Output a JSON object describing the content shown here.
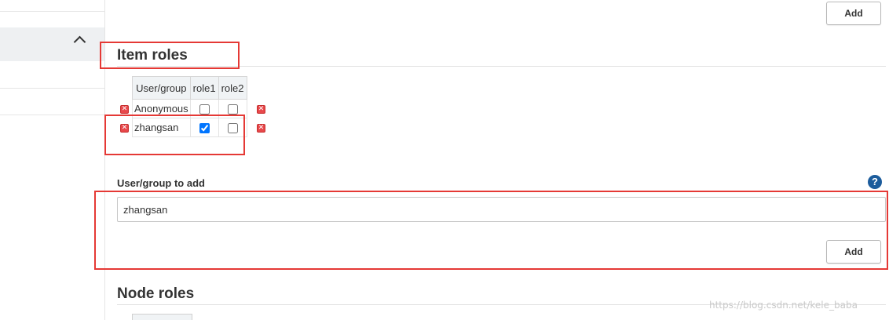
{
  "buttons": {
    "top_add": "Add",
    "user_add": "Add"
  },
  "item_roles": {
    "title": "Item roles",
    "columns": [
      "User/group",
      "role1",
      "role2"
    ],
    "rows": [
      {
        "name": "Anonymous",
        "role1": false,
        "role2": false
      },
      {
        "name": "zhangsan",
        "role1": true,
        "role2": false
      }
    ]
  },
  "add_form": {
    "label": "User/group to add",
    "value": "zhangsan",
    "help": "?"
  },
  "node_roles": {
    "title": "Node roles"
  },
  "icons": {
    "sidebar_toggle": "chevron-up-icon",
    "delete": "delete-x-icon",
    "help": "help-icon"
  },
  "colors": {
    "highlight": "#e53935",
    "help": "#1c5c9c",
    "delete": "#e8484b"
  },
  "watermark": "https://blog.csdn.net/kele_baba"
}
